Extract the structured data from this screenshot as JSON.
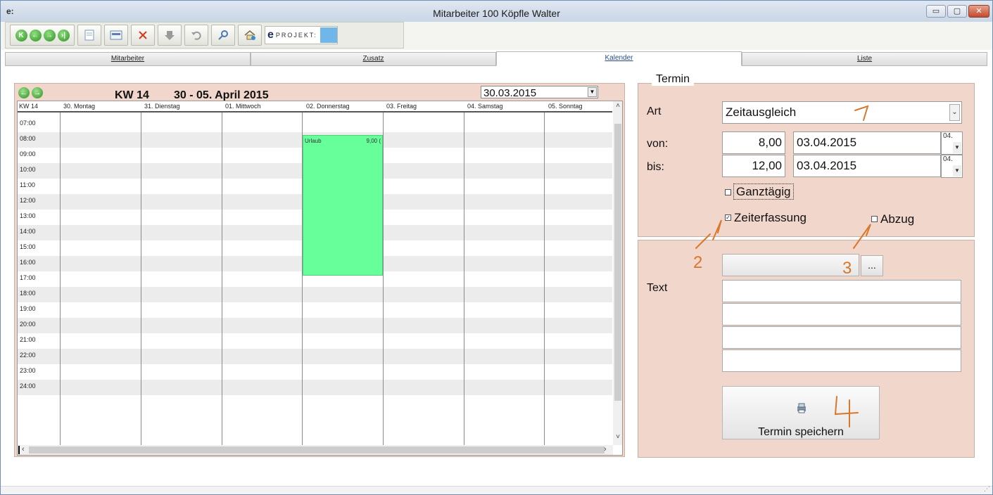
{
  "window": {
    "app_icon": "e:",
    "title": "Mitarbeiter  100   Köpfle Walter",
    "buttons": {
      "minimize": "▭",
      "restore": "▢",
      "close": "✕"
    }
  },
  "toolbar": {
    "nav": [
      "K",
      "←",
      "→",
      "›|"
    ],
    "icons": [
      "new-document-icon",
      "form-icon",
      "delete-icon",
      "save-disabled-icon",
      "undo-icon",
      "search-icon",
      "home-icon"
    ],
    "logo_letter": "e",
    "logo_text": "PROJEKT:"
  },
  "tabs": [
    {
      "label": "Mitarbeiter",
      "active": false
    },
    {
      "label": "Zusatz",
      "active": false
    },
    {
      "label": "Kalender",
      "active": true
    },
    {
      "label": "Liste",
      "active": false
    }
  ],
  "calendar": {
    "week_label": "KW 14",
    "range_label": "30 - 05. April 2015",
    "date_value": "30.03.2015",
    "corner_label": "KW 14",
    "days": [
      "30. Montag",
      "31. Dienstag",
      "01. Mittwoch",
      "02. Donnerstag",
      "03. Freitag",
      "04. Samstag",
      "05. Sonntag"
    ],
    "times": [
      "07:00",
      "08:00",
      "09:00",
      "10:00",
      "11:00",
      "12:00",
      "13:00",
      "14:00",
      "15:00",
      "16:00",
      "17:00",
      "18:00",
      "19:00",
      "20:00",
      "21:00",
      "22:00",
      "23:00",
      "24:00"
    ],
    "event": {
      "label": "Urlaub",
      "value": "9,00 ("
    }
  },
  "termin": {
    "legend": "Termin",
    "art_label": "Art",
    "art_value": "Zeitausgleich",
    "von_label": "von:",
    "von_time": "8,00",
    "von_date": "03.04.2015",
    "von_small": "04.",
    "bis_label": "bis:",
    "bis_time": "12,00",
    "bis_date": "03.04.2015",
    "bis_small": "04.",
    "ganztaegig_label": "Ganztägig",
    "ganztaegig_checked": false,
    "zeiterfassung_label": "Zeiterfassung",
    "zeiterfassung_checked": true,
    "abzug_label": "Abzug",
    "abzug_checked": false
  },
  "text_section": {
    "label": "Text",
    "browse_label": "...",
    "lines": [
      "",
      "",
      "",
      ""
    ]
  },
  "save_button": {
    "label": "Termin speichern"
  },
  "annotations": [
    "1",
    "2",
    "3",
    "4"
  ],
  "colors": {
    "panel_bg": "#f1d6cc",
    "event_fill": "#66ff99",
    "annotation": "#d9772b"
  }
}
